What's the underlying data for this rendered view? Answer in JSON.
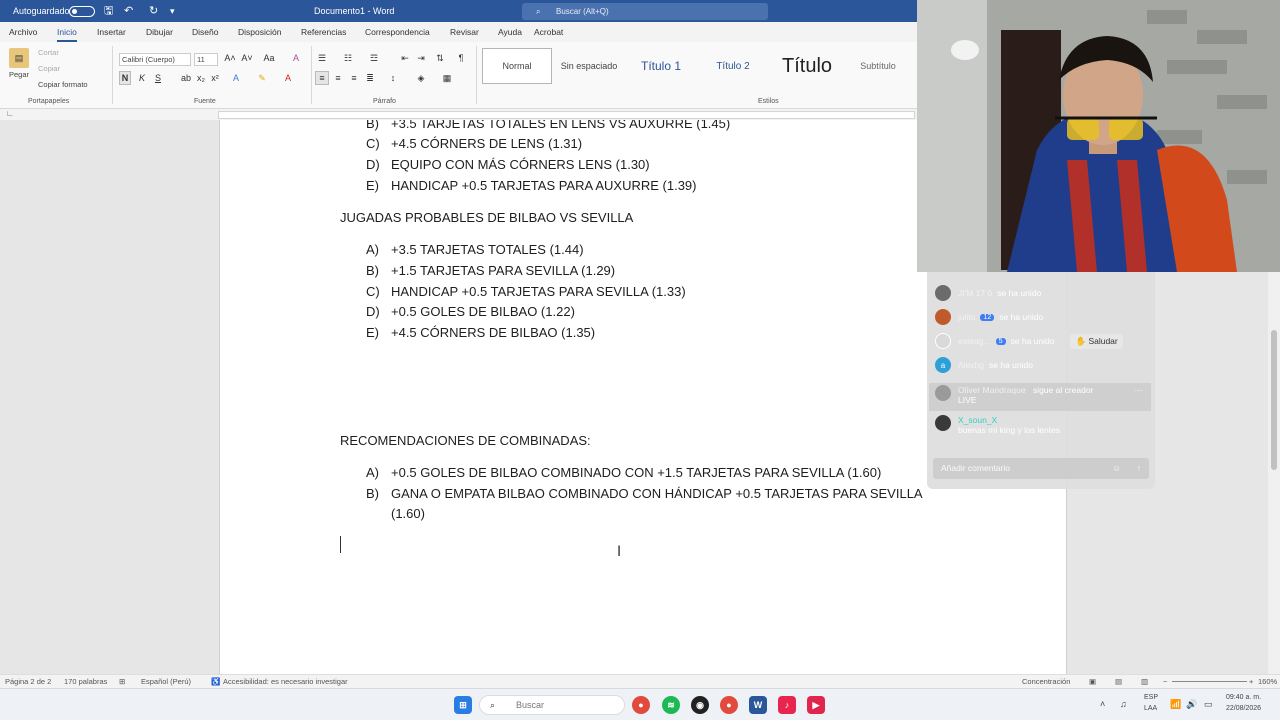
{
  "titlebar": {
    "autosave_label": "Autoguardado",
    "doc_title": "Documento1 - Word",
    "search_placeholder": "Buscar (Alt+Q)"
  },
  "menu_tabs": [
    "Archivo",
    "Inicio",
    "Insertar",
    "Dibujar",
    "Diseño",
    "Disposición",
    "Referencias",
    "Correspondencia",
    "Revisar",
    "Ayuda",
    "Acrobat"
  ],
  "ribbon": {
    "clipboard": {
      "paste": "Pegar",
      "cut": "Cortar",
      "copy": "Copiar",
      "format_painter": "Copiar formato",
      "group": "Portapapeles"
    },
    "font": {
      "name": "Calibri (Cuerpo)",
      "size": "11",
      "group": "Fuente",
      "bold": "N",
      "italic": "K",
      "underline": "S"
    },
    "paragraph_group": "Párrafo",
    "styles": [
      "Normal",
      "Sin espaciado",
      "Título 1",
      "Título 2",
      "Título",
      "Subtítulo"
    ],
    "styles_group": "Estilos"
  },
  "document": {
    "list1": [
      {
        "label": "B)",
        "text": "+3.5 TARJETAS TOTALES EN LENS VS AUXURRE (1.45)"
      },
      {
        "label": "C)",
        "text": "+4.5 CÓRNERS DE LENS (1.31)"
      },
      {
        "label": "D)",
        "text": "EQUIPO CON MÁS CÓRNERS LENS (1.30)"
      },
      {
        "label": "E)",
        "text": "HANDICAP +0.5 TARJETAS PARA AUXURRE (1.39)"
      }
    ],
    "heading2": "JUGADAS PROBABLES DE BILBAO VS SEVILLA",
    "list2": [
      {
        "label": "A)",
        "text": "+3.5 TARJETAS TOTALES (1.44)"
      },
      {
        "label": "B)",
        "text": "+1.5 TARJETAS PARA SEVILLA (1.29)"
      },
      {
        "label": "C)",
        "text": "HANDICAP +0.5 TARJETAS PARA SEVILLA (1.33)"
      },
      {
        "label": "D)",
        "text": "+0.5 GOLES DE BILBAO (1.22)"
      },
      {
        "label": "E)",
        "text": "+4.5 CÓRNERS DE BILBAO (1.35)"
      }
    ],
    "heading3": "RECOMENDACIONES DE COMBINADAS:",
    "list3": [
      {
        "label": "A)",
        "text": "+0.5 GOLES DE BILBAO COMBINADO CON +1.5 TARJETAS PARA SEVILLA (1.60)"
      },
      {
        "label": "B)",
        "text": "GANA O EMPATA BILBAO COMBINADO CON HÁNDICAP +0.5 TARJETAS PARA SEVILLA",
        "cont": "(1.60)"
      }
    ]
  },
  "chat": {
    "messages": [
      {
        "user": "Jt'M 17 ô",
        "badge": "",
        "text": "se ha unido",
        "avatar_color": "#6b6b6b"
      },
      {
        "user": "julito",
        "badge": "12",
        "text": "se ha unido",
        "avatar_color": "#c05a2a"
      },
      {
        "user": "esteag...",
        "badge": "5",
        "text": "se ha unido",
        "avatar_color": "#d9d9d9",
        "action": "Saludar"
      },
      {
        "user": "Alexhg",
        "badge": "",
        "text": "se ha unido",
        "avatar_color": "#2ea0d8",
        "avatar_letter": "a"
      },
      {
        "user": "Oliver Mandraque",
        "badge": "",
        "text": "sigue al creador",
        "text2": "LIVE",
        "avatar_color": "#9a9a9a"
      },
      {
        "user": "X_soun_X",
        "badge": "",
        "text": "buenas mi king y los lentes",
        "avatar_color": "#3a3a3a"
      }
    ],
    "input_placeholder": "Añadir comentario"
  },
  "statusbar": {
    "page": "Página 2 de 2",
    "words": "170 palabras",
    "language": "Español (Perú)",
    "accessibility": "Accesibilidad: es necesario investigar",
    "focus": "Concentración",
    "zoom": "160%"
  },
  "taskbar": {
    "search_placeholder": "Buscar",
    "lang": "ESP",
    "lang2": "LAA",
    "time": "09:40 a. m.",
    "date": "22/08/2026"
  },
  "colors": {
    "word_blue": "#2b579a",
    "chat_bg": "#dedede"
  }
}
